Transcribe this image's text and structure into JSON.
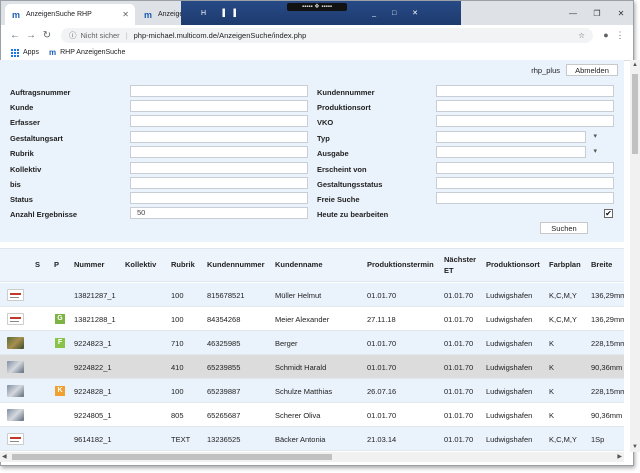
{
  "browser": {
    "active_tab_title": "AnzeigenSuche RHP",
    "inactive_tab_title": "Anzeigen",
    "overlay_black_text": "▪▪▪▪▪ ❖ ▪▪▪▪▪",
    "overlay_icons_left": "H ▐▐",
    "overlay_icons_right": "_ □ ✕",
    "security_label": "Nicht sicher",
    "url": "php-michael.multicom.de/AnzeigenSuche/index.php",
    "bookmarks": [
      {
        "label": "Apps"
      },
      {
        "label": "RHP AnzeigenSuche"
      }
    ]
  },
  "userbar": {
    "username": "rhp_plus",
    "logout_label": "Abmelden"
  },
  "form": {
    "left_fields": [
      {
        "label": "Auftragsnummer",
        "value": ""
      },
      {
        "label": "Kunde",
        "value": ""
      },
      {
        "label": "Erfasser",
        "value": ""
      },
      {
        "label": "Gestaltungsart",
        "value": ""
      },
      {
        "label": "Rubrik",
        "value": ""
      },
      {
        "label": "Kollektiv",
        "value": ""
      },
      {
        "label": "bis",
        "value": ""
      },
      {
        "label": "Status",
        "value": ""
      },
      {
        "label": "Anzahl Ergebnisse",
        "value": "50"
      }
    ],
    "right_fields": [
      {
        "label": "Kundennummer",
        "value": ""
      },
      {
        "label": "Produktionsort",
        "value": ""
      },
      {
        "label": "VKO",
        "value": ""
      },
      {
        "label": "Typ",
        "value": ""
      },
      {
        "label": "Ausgabe",
        "value": ""
      },
      {
        "label": "Erscheint von",
        "value": ""
      },
      {
        "label": "Gestaltungsstatus",
        "value": ""
      },
      {
        "label": "Freie Suche",
        "value": ""
      }
    ],
    "checkbox_label": "Heute zu bearbeiten",
    "checkbox_checked": true,
    "checkbox_mark": "✔",
    "search_label": "Suchen"
  },
  "table": {
    "headers": {
      "s": "S",
      "p": "P",
      "nummer": "Nummer",
      "kollektiv": "Kollektiv",
      "rubrik": "Rubrik",
      "kundennummer": "Kundennummer",
      "kundenname": "Kundenname",
      "produktionstermin": "Produktionstermin",
      "naechster_et_line1": "Nächster",
      "naechster_et_line2": "ET",
      "produktionsort": "Produktionsort",
      "farbplan": "Farbplan",
      "breite": "Breite"
    },
    "rows": [
      {
        "thumb": "text",
        "badge": "",
        "badge_color": "",
        "nummer": "13821287_1",
        "rubrik": "100",
        "kundennummer": "815678521",
        "kundenname": "Müller Helmut",
        "produktionstermin": "01.01.70",
        "naechster_et": "01.01.70",
        "produktionsort": "Ludwigshafen",
        "farbplan": "K,C,M,Y",
        "breite": "136,29mm"
      },
      {
        "thumb": "text",
        "badge": "G",
        "badge_color": "#7cb342",
        "nummer": "13821288_1",
        "rubrik": "100",
        "kundennummer": "84354268",
        "kundenname": "Meier Alexander",
        "produktionstermin": "27.11.18",
        "naechster_et": "01.01.70",
        "produktionsort": "Ludwigshafen",
        "farbplan": "K,C,M,Y",
        "breite": "136,29mm"
      },
      {
        "thumb": "photo",
        "badge": "F",
        "badge_color": "#8bc34a",
        "nummer": "9224823_1",
        "rubrik": "710",
        "kundennummer": "46325985",
        "kundenname": "Berger",
        "produktionstermin": "01.01.70",
        "naechster_et": "01.01.70",
        "produktionsort": "Ludwigshafen",
        "farbplan": "K",
        "breite": "228,15mm"
      },
      {
        "thumb": "photo2",
        "badge": "",
        "badge_color": "",
        "nummer": "9224822_1",
        "rubrik": "410",
        "kundennummer": "65239855",
        "kundenname": "Schmidt Harald",
        "produktionstermin": "01.01.70",
        "naechster_et": "01.01.70",
        "produktionsort": "Ludwigshafen",
        "farbplan": "K",
        "breite": "90,36mm"
      },
      {
        "thumb": "photo2",
        "badge": "K",
        "badge_color": "#f0a030",
        "nummer": "9224828_1",
        "rubrik": "100",
        "kundennummer": "65239887",
        "kundenname": "Schulze Matthias",
        "produktionstermin": "26.07.16",
        "naechster_et": "01.01.70",
        "produktionsort": "Ludwigshafen",
        "farbplan": "K",
        "breite": "228,15mm"
      },
      {
        "thumb": "photo2",
        "badge": "",
        "badge_color": "",
        "nummer": "9224805_1",
        "rubrik": "805",
        "kundennummer": "65265687",
        "kundenname": "Scherer Oliva",
        "produktionstermin": "01.01.70",
        "naechster_et": "01.01.70",
        "produktionsort": "Ludwigshafen",
        "farbplan": "K",
        "breite": "90,36mm"
      },
      {
        "thumb": "text",
        "badge": "",
        "badge_color": "",
        "nummer": "9614182_1",
        "rubrik": "TEXT",
        "kundennummer": "13236525",
        "kundenname": "Bäcker Antonia",
        "produktionstermin": "21.03.14",
        "naechster_et": "01.01.70",
        "produktionsort": "Ludwigshafen",
        "farbplan": "K,C,M,Y",
        "breite": "1Sp"
      }
    ]
  },
  "colors": {
    "panel_bg": "#eaf2fb",
    "row_alt_bg": "#eaf2fb",
    "row_highlight_bg": "#dcdcdc",
    "brand_blue": "#1a5db5"
  }
}
